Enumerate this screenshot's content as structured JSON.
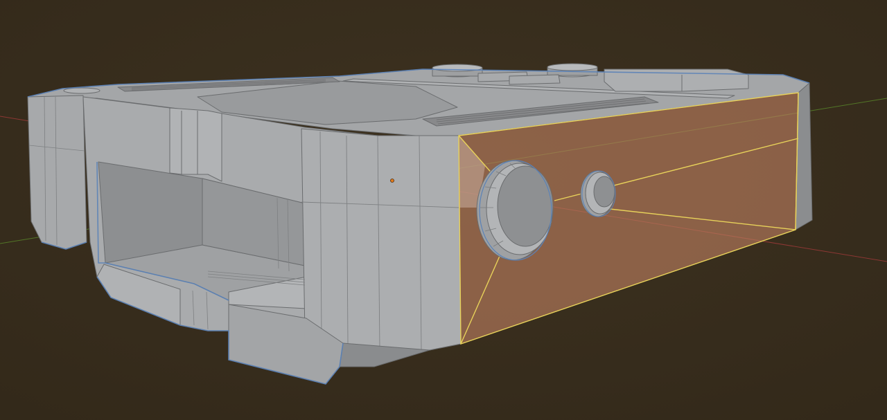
{
  "viewport": {
    "background": "#3a2f1f",
    "axis_x_color": "#a33a3a",
    "axis_y_color": "#5a8a2a"
  },
  "model": {
    "base_color": "#a9abad",
    "top_color": "#9c9ea0",
    "side_color": "#8e9093",
    "dark_color": "#7c7e80",
    "wire_color": "#6a6c6e",
    "edge_highlight_color": "#5a82b8",
    "selected_face_color": "#b87c5e",
    "selected_face_opacity": 0.65,
    "selected_edge_color": "#e8d25a",
    "origin_color": "#e07a1a"
  }
}
